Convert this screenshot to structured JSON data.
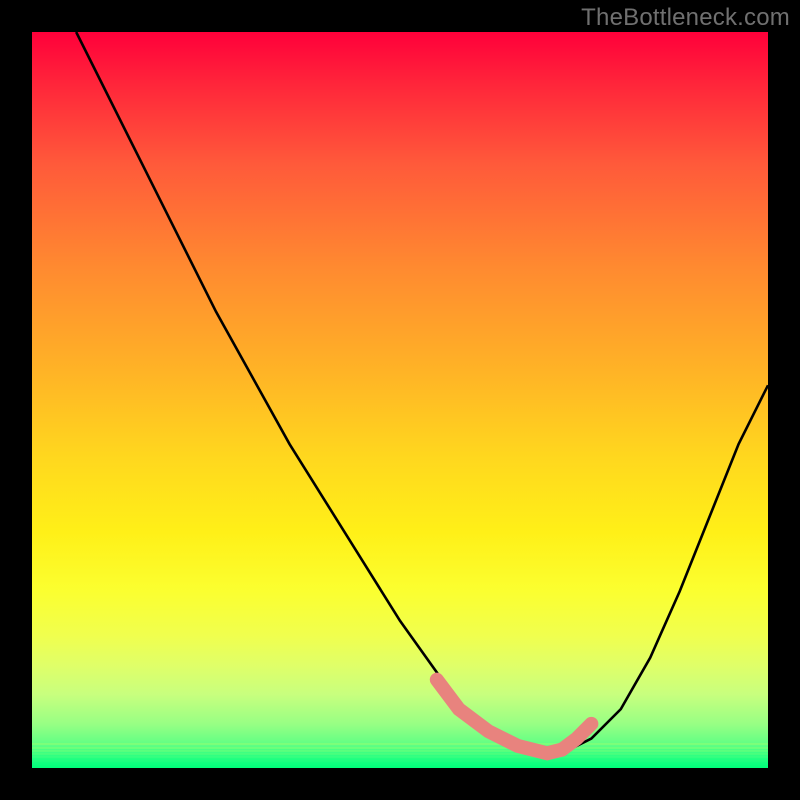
{
  "watermark": "TheBottleneck.com",
  "chart_data": {
    "type": "line",
    "title": "",
    "xlabel": "",
    "ylabel": "",
    "xlim": [
      0,
      100
    ],
    "ylim": [
      0,
      100
    ],
    "grid": false,
    "background_gradient": [
      "#ff003a",
      "#ff8a30",
      "#ffd81e",
      "#fbff30",
      "#5cff84",
      "#00ff7a"
    ],
    "series": [
      {
        "name": "bottleneck-curve",
        "color": "#000000",
        "x": [
          6,
          10,
          15,
          20,
          25,
          30,
          35,
          40,
          45,
          50,
          55,
          58,
          62,
          66,
          70,
          72,
          76,
          80,
          84,
          88,
          92,
          96,
          100
        ],
        "y": [
          100,
          92,
          82,
          72,
          62,
          53,
          44,
          36,
          28,
          20,
          13,
          8,
          5,
          3,
          2,
          2,
          4,
          8,
          15,
          24,
          34,
          44,
          52
        ]
      }
    ],
    "highlight_segment": {
      "name": "optimal-zone",
      "color": "#e8837e",
      "x": [
        55,
        58,
        62,
        66,
        70,
        72
      ],
      "y": [
        12,
        8,
        5,
        3,
        2,
        2.5
      ]
    },
    "highlight_segment_2": {
      "name": "optimal-zone-right",
      "color": "#e8837e",
      "x": [
        72,
        74,
        76
      ],
      "y": [
        2.5,
        4,
        6
      ]
    }
  }
}
